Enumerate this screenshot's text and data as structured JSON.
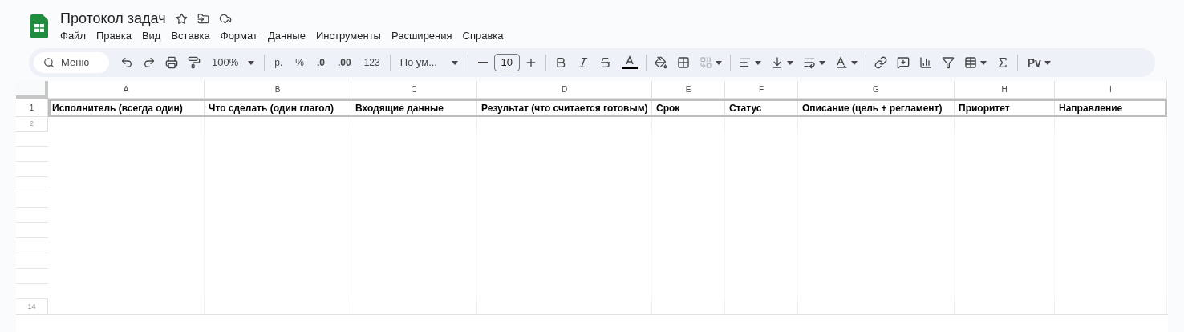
{
  "document": {
    "title": "Протокол задач"
  },
  "menu": [
    "Файл",
    "Правка",
    "Вид",
    "Вставка",
    "Формат",
    "Данные",
    "Инструменты",
    "Расширения",
    "Справка"
  ],
  "toolbar": {
    "search": "Меню",
    "zoom": "100%",
    "currency": "р.",
    "percent": "%",
    "decrease_decimals": ".0",
    "increase_decimals": ".00",
    "number_format": "123",
    "font": "По ум...",
    "font_size": "10",
    "merge_disabled": true,
    "input_tools": "Pv"
  },
  "columns": [
    "A",
    "B",
    "C",
    "D",
    "E",
    "F",
    "G",
    "H",
    "I"
  ],
  "header_row": {
    "number": "1",
    "outlined": true,
    "cells": [
      "Исполнитель (всегда один)",
      "Что сделать (один глагол)",
      "Входящие данные",
      "Результат (что считается готовым)",
      "Срок",
      "Статус",
      "Описание (цель + регламент)",
      "Приоритет",
      "Направление"
    ]
  },
  "blank_rows": {
    "first": "2",
    "last": "14"
  }
}
